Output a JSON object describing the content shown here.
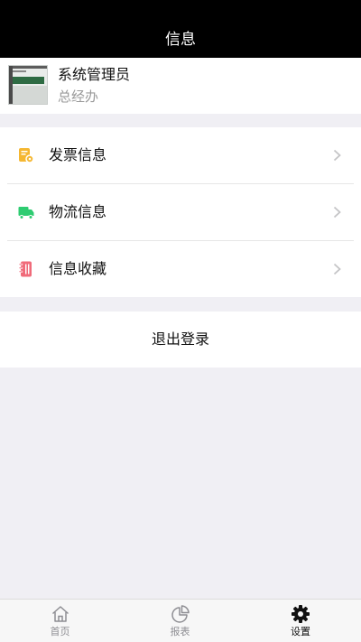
{
  "header": {
    "title": "信息"
  },
  "profile": {
    "name": "系统管理员",
    "department": "总经办"
  },
  "menu": {
    "items": [
      {
        "label": "发票信息",
        "icon": "invoice-icon",
        "color": "#f5b731"
      },
      {
        "label": "物流信息",
        "icon": "truck-icon",
        "color": "#2ecc71"
      },
      {
        "label": "信息收藏",
        "icon": "notebook-icon",
        "color": "#f06b7a"
      }
    ]
  },
  "logout": {
    "label": "退出登录"
  },
  "tabbar": {
    "tabs": [
      {
        "label": "首页",
        "icon": "home-icon",
        "active": false
      },
      {
        "label": "报表",
        "icon": "pie-chart-icon",
        "active": false
      },
      {
        "label": "设置",
        "icon": "gear-icon",
        "active": true
      }
    ]
  }
}
